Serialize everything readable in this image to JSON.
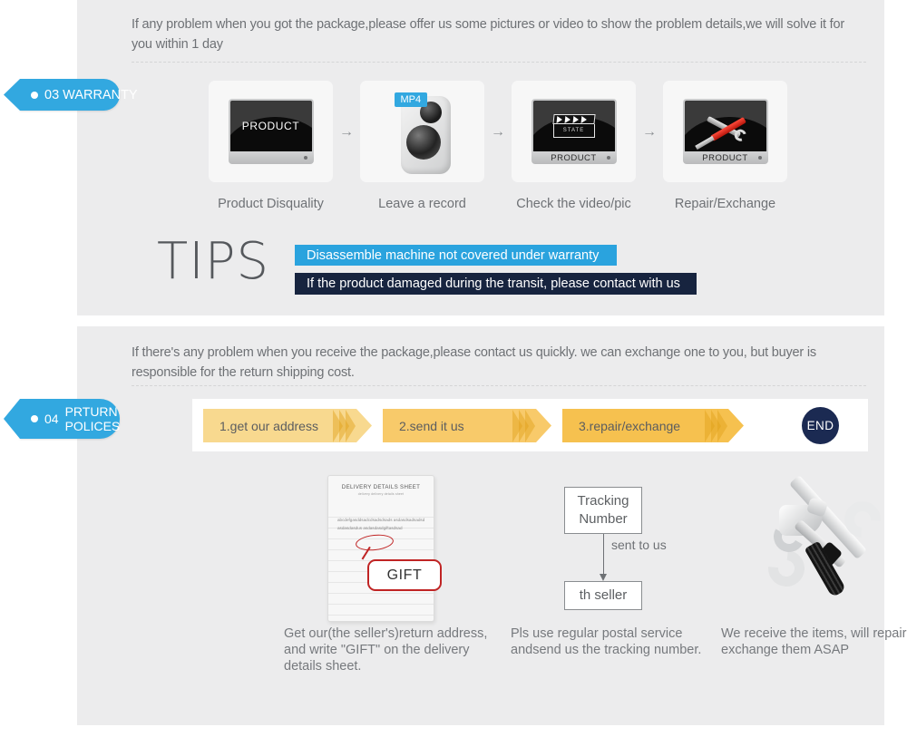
{
  "warranty": {
    "badge": {
      "number": "03",
      "label": "WARRANTY"
    },
    "intro": "If any problem when you got the package,please offer us some pictures or video to show the problem details,we will solve it for you within 1 day",
    "steps": [
      {
        "label": "Product Disquality",
        "screen_text": "PRODUCT",
        "icon": "monitor-product-icon"
      },
      {
        "label": "Leave a record",
        "tag": "MP4",
        "icon": "mp4-recorder-icon"
      },
      {
        "label": "Check the video/pic",
        "base_text": "PRODUCT",
        "clapper_text": "STATE",
        "icon": "monitor-clapper-icon"
      },
      {
        "label": "Repair/Exchange",
        "base_text": "PRODUCT",
        "icon": "monitor-tools-icon"
      }
    ],
    "arrow_glyph": "→",
    "tips": {
      "title": "TIPS",
      "line1": "Disassemble machine not covered under warranty",
      "line2": "If the product damaged during the transit, please contact with us"
    }
  },
  "returns": {
    "badge": {
      "number": "04",
      "label_line1": "PRTURN",
      "label_line2": "POLICES"
    },
    "intro": "If  there's any problem when you receive the package,please contact us quickly. we can exchange one to you, but buyer is responsible for the return shipping cost.",
    "flow": [
      {
        "label": "1.get our address"
      },
      {
        "label": "2.send it us"
      },
      {
        "label": "3.repair/exchange"
      }
    ],
    "end_label": "END",
    "columns": [
      {
        "art": "delivery-details-sheet",
        "sheet": {
          "title": "DELIVERY DETAILS SHEET",
          "subtitle": "delivery          delivery details sheet",
          "body": "abcdefgasddsadcdsadsdsads asdasdsadsadsdasdasdasdus asdasdasdgiftasdsad",
          "bubble": "GIFT"
        },
        "caption": "Get our(the seller's)return address, and write \"GIFT\" on the delivery details sheet."
      },
      {
        "art": "tracking-number-diagram",
        "diagram": {
          "top_box": "Tracking Number",
          "connector_label": "sent to us",
          "bottom_box": "th seller"
        },
        "caption": "Pls use regular postal service andsend us the tracking number."
      },
      {
        "art": "hammer-wrench-screwdriver",
        "caption": "We receive the items, will repair or exchange them ASAP"
      }
    ]
  },
  "colors": {
    "badge_blue": "#32a8e0",
    "tip_blue": "#2aa3de",
    "tip_navy": "#17243f",
    "end_navy": "#1b2a52",
    "chev_light": "#f8d98f",
    "chev_mid": "#f8ca6a",
    "chev_dark": "#f6c14f",
    "panel_bg": "#ececed"
  }
}
